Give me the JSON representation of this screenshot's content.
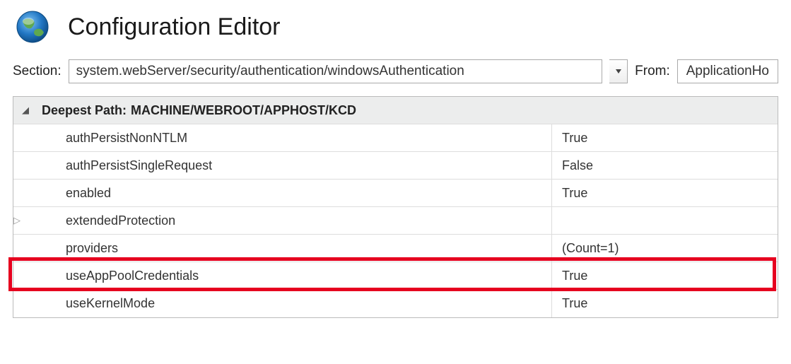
{
  "header": {
    "title": "Configuration Editor"
  },
  "toolbar": {
    "section_label": "Section:",
    "section_value": "system.webServer/security/authentication/windowsAuthentication",
    "from_label": "From:",
    "from_value": "ApplicationHo"
  },
  "grid": {
    "header_prefix": "Deepest Path:",
    "header_path": "MACHINE/WEBROOT/APPHOST/KCD",
    "rows": [
      {
        "name": "authPersistNonNTLM",
        "value": "True",
        "expandable": false
      },
      {
        "name": "authPersistSingleRequest",
        "value": "False",
        "expandable": false
      },
      {
        "name": "enabled",
        "value": "True",
        "expandable": false
      },
      {
        "name": "extendedProtection",
        "value": "",
        "expandable": true
      },
      {
        "name": "providers",
        "value": "(Count=1)",
        "expandable": false
      },
      {
        "name": "useAppPoolCredentials",
        "value": "True",
        "expandable": false
      },
      {
        "name": "useKernelMode",
        "value": "True",
        "expandable": false
      }
    ]
  }
}
